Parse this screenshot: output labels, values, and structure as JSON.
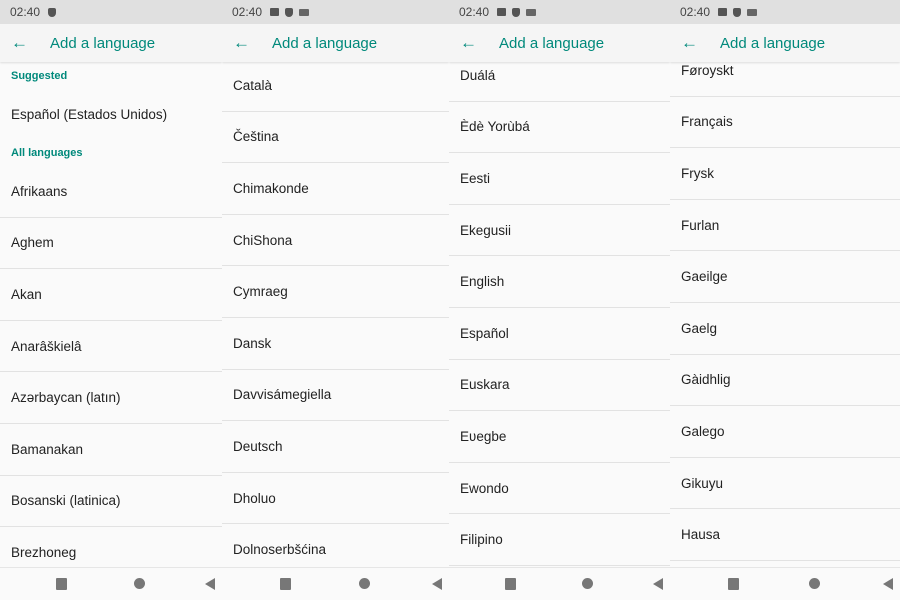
{
  "panels": [
    {
      "status": {
        "time": "02:40",
        "icons": [
          "shield-icon"
        ]
      },
      "toolbar": {
        "back_icon": "←",
        "title": "Add a language"
      },
      "suggested_header": "Suggested",
      "suggested": [
        "Español (Estados Unidos)"
      ],
      "all_header": "All languages",
      "items": [
        "Afrikaans",
        "Aghem",
        "Akan",
        "Anarâškielâ",
        "Azərbaycan (latın)",
        "Bamanakan",
        "Bosanski (latinica)",
        "Brezhoneg"
      ]
    },
    {
      "status": {
        "time": "02:40",
        "icons": [
          "image-icon",
          "shield-icon",
          "keyboard-icon"
        ]
      },
      "toolbar": {
        "back_icon": "←",
        "title": "Add a language"
      },
      "items": [
        "Català",
        "Čeština",
        "Chimakonde",
        "ChiShona",
        "Cymraeg",
        "Dansk",
        "Davvisámegiella",
        "Deutsch",
        "Dholuo",
        "Dolnoserbšćina"
      ]
    },
    {
      "status": {
        "time": "02:40",
        "icons": [
          "image-icon",
          "shield-icon",
          "keyboard-icon"
        ]
      },
      "toolbar": {
        "back_icon": "←",
        "title": "Add a language"
      },
      "items": [
        "Duálá",
        "Èdè Yorùbá",
        "Eesti",
        "Ekegusii",
        "English",
        "Español",
        "Euskara",
        "Eʋegbe",
        "Ewondo",
        "Filipino"
      ]
    },
    {
      "status": {
        "time": "02:40",
        "icons": [
          "image-icon",
          "shield-icon",
          "keyboard-icon"
        ]
      },
      "toolbar": {
        "back_icon": "←",
        "title": "Add a language"
      },
      "items": [
        "Føroyskt",
        "Français",
        "Frysk",
        "Furlan",
        "Gaeilge",
        "Gaelg",
        "Gàidhlig",
        "Galego",
        "Gikuyu",
        "Hausa"
      ]
    }
  ]
}
